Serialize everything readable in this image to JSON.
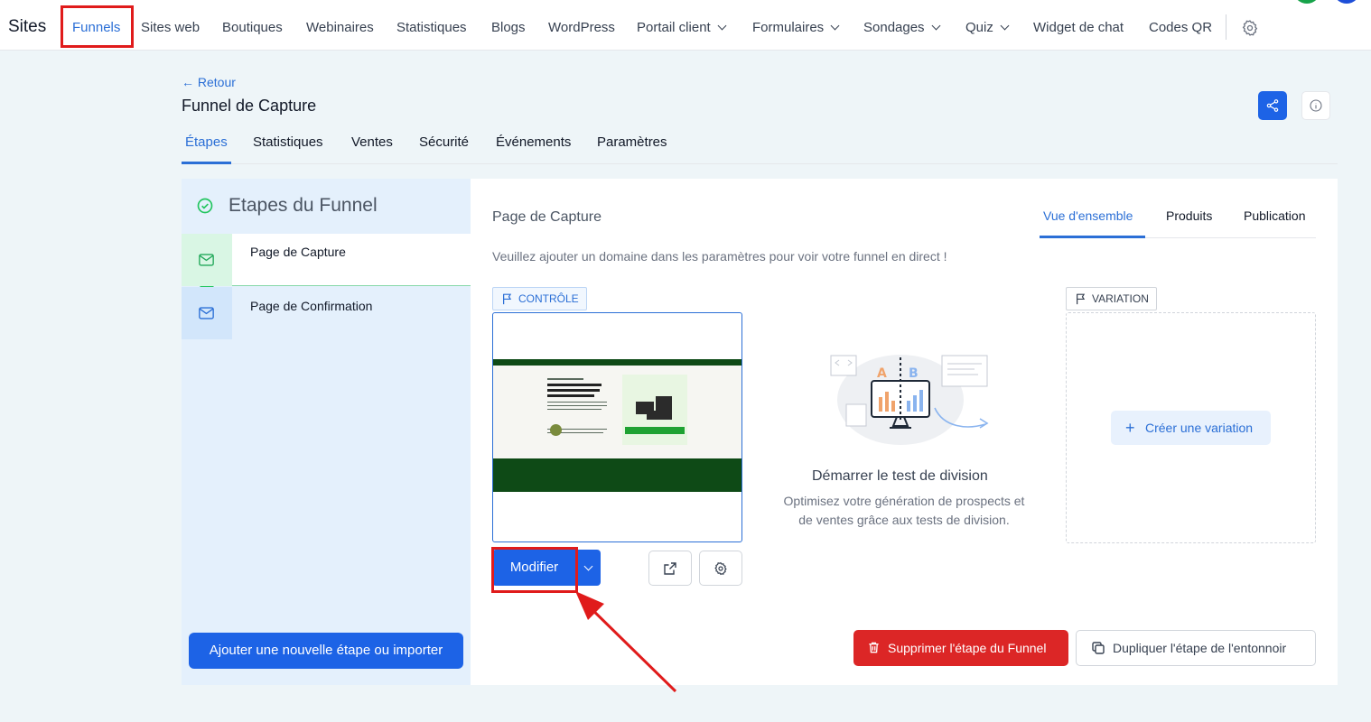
{
  "nav": {
    "brand": "Sites",
    "items": [
      {
        "label": "Funnels",
        "active": true
      },
      {
        "label": "Sites web"
      },
      {
        "label": "Boutiques"
      },
      {
        "label": "Webinaires"
      },
      {
        "label": "Statistiques"
      },
      {
        "label": "Blogs"
      },
      {
        "label": "WordPress"
      },
      {
        "label": "Portail client",
        "dropdown": true
      },
      {
        "label": "Formulaires",
        "dropdown": true
      },
      {
        "label": "Sondages",
        "dropdown": true
      },
      {
        "label": "Quiz",
        "dropdown": true
      },
      {
        "label": "Widget de chat"
      },
      {
        "label": "Codes QR"
      }
    ]
  },
  "header": {
    "back_label": "Retour",
    "title": "Funnel de Capture",
    "tabs": [
      "Étapes",
      "Statistiques",
      "Ventes",
      "Sécurité",
      "Événements",
      "Paramètres"
    ]
  },
  "sidebar": {
    "title": "Etapes du Funnel",
    "steps": [
      "Page de Capture",
      "Page de Confirmation"
    ],
    "add_label": "Ajouter une nouvelle étape ou importer"
  },
  "main": {
    "title": "Page de Capture",
    "tabs": [
      "Vue d'ensemble",
      "Produits",
      "Publication"
    ],
    "notice": "Veuillez ajouter un domaine dans les paramètres pour voir votre funnel en direct !",
    "control_tag": "CONTRÔLE",
    "variation_tag": "VARIATION",
    "edit_label": "Modifier",
    "split_test_title": "Démarrer le test de division",
    "split_test_desc": "Optimisez votre génération de prospects et de ventes grâce aux tests de division.",
    "create_variation_label": "Créer une variation",
    "delete_label": "Supprimer l'étape du Funnel",
    "duplicate_label": "Dupliquer l'étape de l'entonnoir"
  },
  "colors": {
    "primary": "#1d63e6",
    "danger": "#dc2626",
    "highlight": "#e01b1b",
    "success": "#22c55e"
  }
}
